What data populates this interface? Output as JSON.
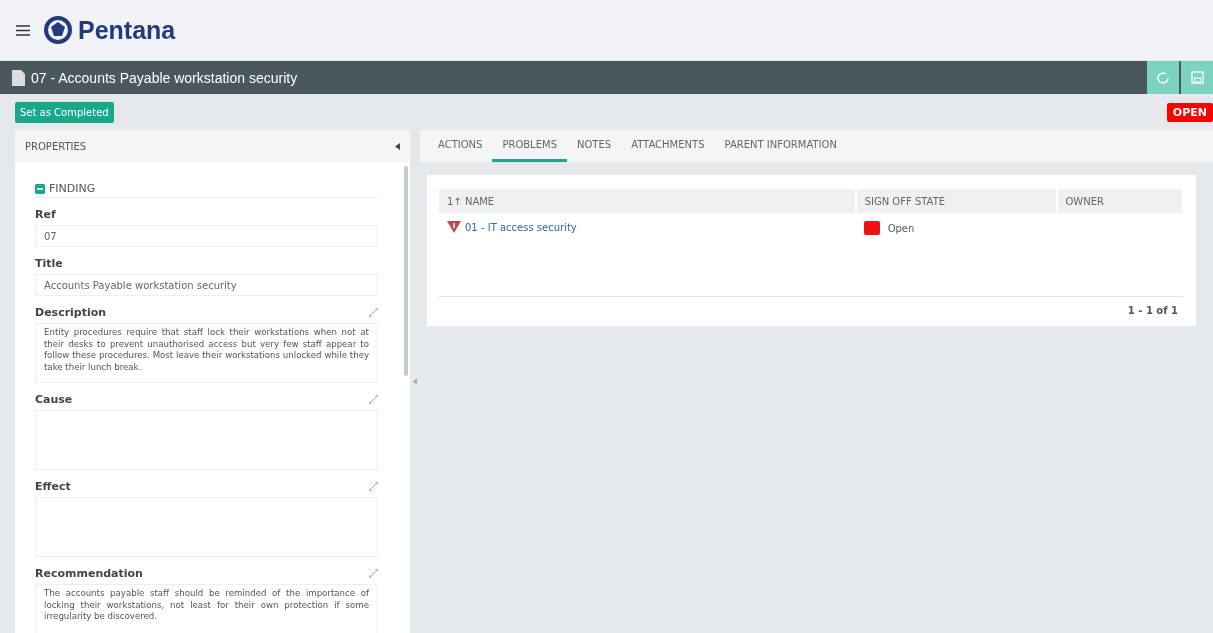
{
  "app": {
    "logo_text": "Pentana"
  },
  "record": {
    "title": "07 - Accounts Payable workstation security",
    "status": "OPEN"
  },
  "actions": [
    {
      "label": "Set as Completed"
    }
  ],
  "properties": {
    "title": "PROPERTIES",
    "section": {
      "title": "FINDING",
      "expanded": true
    },
    "fields": [
      {
        "label": "Ref",
        "kind": "input",
        "value": "07",
        "expandable": false
      },
      {
        "label": "Title",
        "kind": "input",
        "value": "Accounts Payable workstation security",
        "expandable": false
      },
      {
        "label": "Description",
        "kind": "textarea",
        "value": "Entity procedures require that staff lock their workstations when not at their desks to prevent unauthorised access but very few staff appear to follow these procedures.  Most leave their workstations unlocked while they take their lunch break.",
        "expandable": true
      },
      {
        "label": "Cause",
        "kind": "textarea",
        "expandable": true
      },
      {
        "label": "Effect",
        "kind": "textarea",
        "expandable": true
      },
      {
        "label": "Recommendation",
        "kind": "textarea",
        "value": "The accounts payable staff should be reminded of the importance of locking their workstations, not least for their own protection if some irregularity be discovered.",
        "expandable": true
      }
    ]
  },
  "tabs": [
    {
      "label": "ACTIONS",
      "selected": false
    },
    {
      "label": "PROBLEMS",
      "selected": true
    },
    {
      "label": "NOTES",
      "selected": false
    },
    {
      "label": "ATTACHMENTS",
      "selected": false
    },
    {
      "label": "PARENT INFORMATION",
      "selected": false
    }
  ],
  "table": {
    "sort_indicator": "1↑",
    "columns": [
      "NAME",
      "SIGN OFF STATE",
      "OWNER"
    ],
    "rows": [
      {
        "name": "01 - IT access security",
        "state": "Open",
        "color": "#ee1111"
      }
    ],
    "pager": "1 - 1 of 1"
  }
}
